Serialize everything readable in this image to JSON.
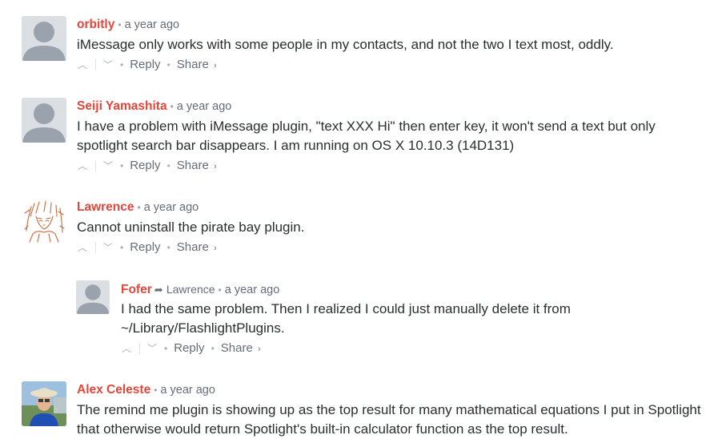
{
  "comments": [
    {
      "author": "orbitly",
      "time": "a year ago",
      "text": "iMessage only works with some people in my contacts, and not the two I text most, oddly.",
      "avatar": "default-avatar"
    },
    {
      "author": "Seiji Yamashita",
      "time": "a year ago",
      "text": "I have a problem with iMessage plugin, \"text XXX Hi\" then enter key, it won't send a text but only spotlight search bar disappears. I am running on OS X 10.10.3 (14D131)",
      "avatar": "default-avatar"
    },
    {
      "author": "Lawrence",
      "time": "a year ago",
      "text": "Cannot uninstall the pirate bay plugin.",
      "avatar": "anime-sketch-avatar"
    },
    {
      "author": "Fofer",
      "reply_to": "Lawrence",
      "time": "a year ago",
      "text": "I had the same problem. Then I realized I could just manually delete it from ~/Library/FlashlightPlugins.",
      "avatar": "default-avatar"
    },
    {
      "author": "Alex Celeste",
      "time": "a year ago",
      "text": "The remind me plugin is showing up as the top result for many mathematical equations I put in Spotlight that otherwise would return Spotlight's built-in calculator function as the top result.",
      "avatar": "photo-avatar"
    }
  ],
  "actions": {
    "upvote_icon": "chevron-up-icon",
    "downvote_icon": "chevron-down-icon",
    "reply_label": "Reply",
    "share_label": "Share",
    "share_chevron": "›",
    "separator": "•"
  },
  "colors": {
    "author": "#e5453b",
    "meta": "#656c7a",
    "text": "#2a2e2e",
    "avatar_bg": "#dbdfe4",
    "avatar_fg": "#9aa3ad"
  }
}
